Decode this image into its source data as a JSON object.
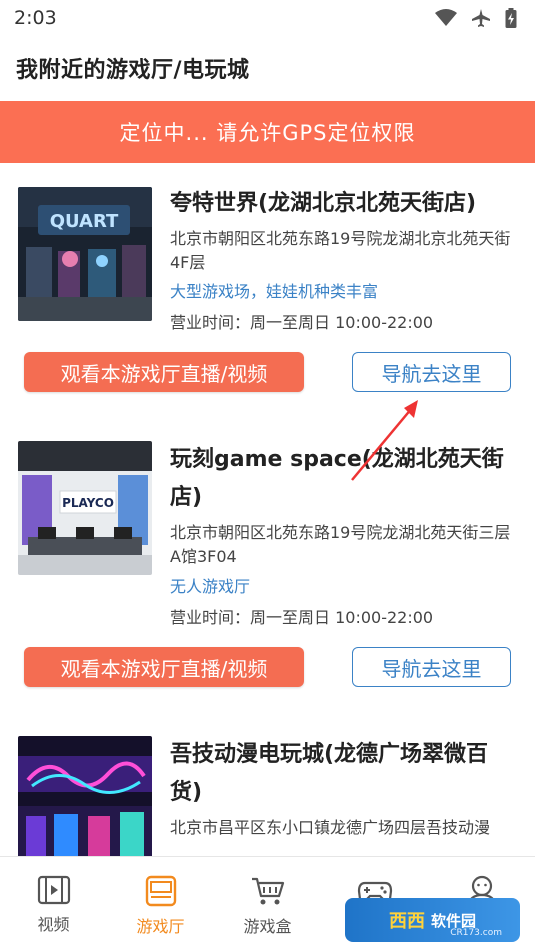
{
  "status_bar": {
    "time": "2:03"
  },
  "page": {
    "title": "我附近的游戏厅/电玩城"
  },
  "banner": {
    "text": "定位中... 请允许GPS定位权限"
  },
  "venues": [
    {
      "name": "夸特世界(龙湖北京北苑天街店)",
      "address": "北京市朝阳区北苑东路19号院龙湖北京北苑天街4F层",
      "tags": "大型游戏场，娃娃机种类丰富",
      "hours": "营业时间：周一至周日 10:00-22:00",
      "watch_label": "观看本游戏厅直播/视频",
      "nav_label": "导航去这里",
      "thumb_sign": "QUART"
    },
    {
      "name": "玩刻game space(龙湖北苑天街店)",
      "address": "北京市朝阳区北苑东路19号院龙湖北苑天街三层A馆3F04",
      "tags": "无人游戏厅",
      "hours": "营业时间：周一至周日 10:00-22:00",
      "watch_label": "观看本游戏厅直播/视频",
      "nav_label": "导航去这里",
      "thumb_sign": "PLAYCO"
    },
    {
      "name": "吾技动漫电玩城(龙德广场翠微百货)",
      "address": "北京市昌平区东小口镇龙德广场四层吾技动漫",
      "tags": "",
      "hours": "",
      "watch_label": "",
      "nav_label": "",
      "thumb_sign": ""
    }
  ],
  "bottom_nav": {
    "items": [
      {
        "label": "视频",
        "icon": "film-icon"
      },
      {
        "label": "游戏厅",
        "icon": "arcade-icon"
      },
      {
        "label": "游戏盒",
        "icon": "cart-icon"
      },
      {
        "label": "",
        "icon": "gamepad-icon"
      },
      {
        "label": "",
        "icon": "profile-icon"
      }
    ],
    "active_index": 1
  },
  "watermark": {
    "main": "西西",
    "text": "软件园",
    "sub": "CR173.com"
  },
  "colors": {
    "accent": "#fb6f53",
    "link": "#3b82c6",
    "active_nav": "#f28a1e"
  }
}
